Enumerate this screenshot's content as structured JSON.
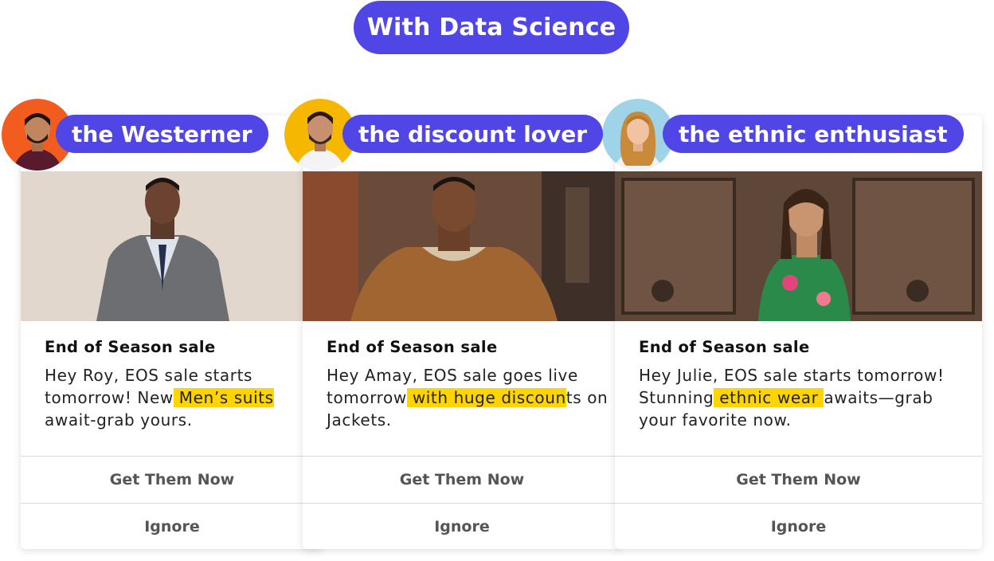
{
  "header": {
    "title": "With Data Science"
  },
  "cards": [
    {
      "persona": "the Westerner",
      "title": "End of Season sale",
      "body_pre": "Hey Roy, EOS sale starts tomorrow! New",
      "body_hl": " Men’s suits ",
      "body_post": "await-grab yours.",
      "primary_label": "Get Them Now",
      "ignore_label": "Ignore",
      "avatar_bg": "#f25c1f"
    },
    {
      "persona": "the discount lover",
      "title": "End of Season sale",
      "body_pre": "Hey Amay, EOS sale goes live tomorrow",
      "body_hl": " with huge discoun",
      "body_post": "ts on Jackets.",
      "primary_label": "Get Them Now",
      "ignore_label": "Ignore",
      "avatar_bg": "#f5b700"
    },
    {
      "persona": "the ethnic enthusiast",
      "title": "End of Season sale",
      "body_pre": "Hey Julie, EOS sale starts tomorrow! Stunning",
      "body_hl": " ethnic wear ",
      "body_post": "awaits—grab your favorite now.",
      "primary_label": "Get Them Now",
      "ignore_label": "Ignore",
      "avatar_bg": "#9fd3e8"
    }
  ],
  "colors": {
    "accent": "#5046e5",
    "highlight": "#ffd500"
  }
}
